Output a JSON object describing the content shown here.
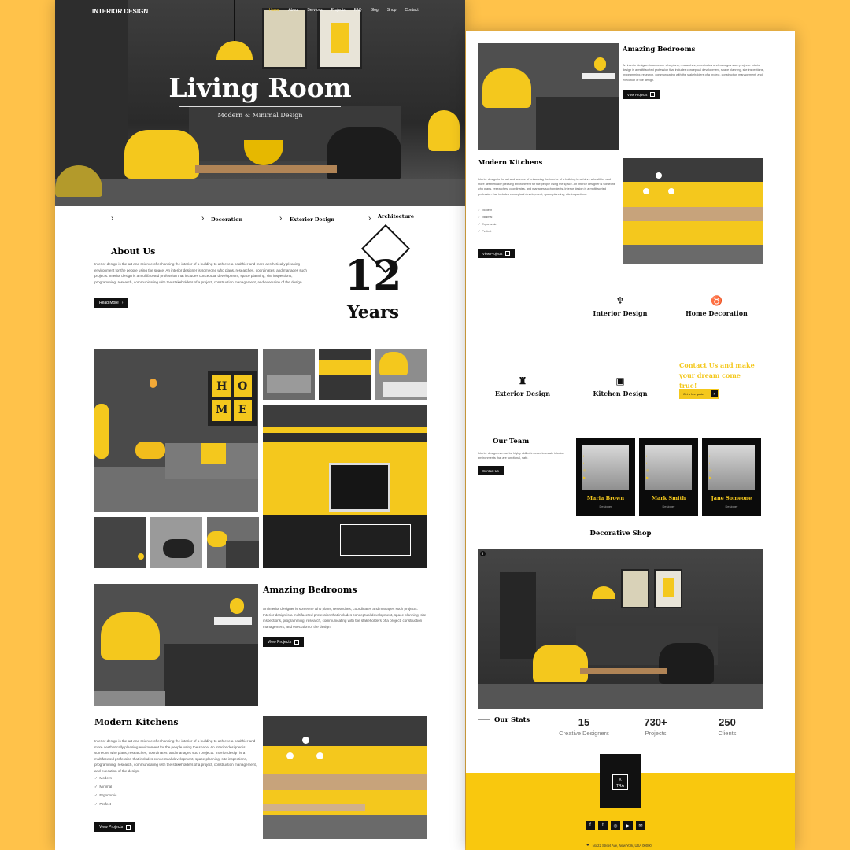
{
  "left": {
    "nav": {
      "brand": "INTERIOR DESIGN",
      "links": [
        "Home",
        "About",
        "Services",
        "Projects",
        "FAQ",
        "Blog",
        "Shop",
        "Contact"
      ]
    },
    "hero": {
      "title": "Living Room",
      "subtitle": "Modern & Minimal Design"
    },
    "categories": [
      "Decoration",
      "Exterior Design",
      "Architecture"
    ],
    "about": {
      "title": "About Us",
      "text": "Interior design is the art and science of enhancing the interior of a building to achieve a healthier and more aesthetically pleasing environment for the people using the space. An interior designer is someone who plans, researches, coordinates, and manages such projects. Interior design is a multifaceted profession that includes conceptual development, space planning, site inspections, programming, research, communicating with the stakeholders of a project, construction management, and execution of the design.",
      "button": "Read More",
      "years_number": "12",
      "years_label": "Years"
    },
    "gallery": {
      "sign_letters": [
        "H",
        "O",
        "M",
        "E"
      ]
    },
    "bedrooms": {
      "title": "Amazing Bedrooms",
      "text": "An interior designer is someone who plans, researches, coordinates and manages such projects. Interior design is a multifaceted profession that includes conceptual development, space planning, site inspections, programming, research, communicating with the stakeholders of a project, construction management, and execution of the design.",
      "button": "View Projects"
    },
    "kitchens": {
      "title": "Modern Kitchens",
      "text": "Interior design is the art and science of enhancing the interior of a building to achieve a healthier and more aesthetically pleasing environment for the people using the space. An interior designer is someone who plans, researches, coordinates, and manages such projects. Interior design is a multifaceted profession that includes conceptual development, space planning, site inspections, programming, research, communicating with the stakeholders of a project, construction management, and execution of the design.",
      "checks": [
        "Modern",
        "Minimal",
        "Ergonomic",
        "Perfect"
      ],
      "button": "View Projects"
    }
  },
  "right": {
    "bedrooms": {
      "title": "Amazing Bedrooms",
      "text": "An interior designer is someone who plans, researches, coordinates and manages such projects. Interior design is a multifaceted profession that includes conceptual development, space planning, site inspections, programming, research, communicating with the stakeholders of a project, construction management, and execution of the design.",
      "button": "View Projects"
    },
    "kitchens": {
      "title": "Modern Kitchens",
      "text": "Interior design is the art and science of enhancing the interior of a building to achieve a healthier and more aesthetically pleasing environment for the people using the space. An interior designer is someone who plans, researches, coordinates, and manages such projects. Interior design is a multifaceted profession that includes conceptual development, space planning, site inspections.",
      "checks": [
        "Modern",
        "Minimal",
        "Ergonomic",
        "Perfect"
      ],
      "button": "View Projects"
    },
    "services": {
      "items": [
        "Interior Design",
        "Home Decoration",
        "Exterior Design",
        "Kitchen Design"
      ],
      "cta_title": "Contact Us and make your dream come true!",
      "cta_button": "Get a free quote"
    },
    "team": {
      "title": "Our Team",
      "text": "Interior designers must be highly skilled in order to create interior environments that are functional, safe.",
      "button": "Contact Us",
      "members": [
        {
          "name": "Maria Brown",
          "role": "Designer"
        },
        {
          "name": "Mark Smith",
          "role": "Designer"
        },
        {
          "name": "Jane Someone",
          "role": "Designer"
        }
      ]
    },
    "shop": {
      "title": "Decorative Shop"
    },
    "stats": {
      "title": "Our Stats",
      "items": [
        {
          "value": "15",
          "label": "Creative Designers"
        },
        {
          "value": "730+",
          "label": "Projects"
        },
        {
          "value": "250",
          "label": "Clients"
        }
      ]
    },
    "footer": {
      "logo_top": "X",
      "logo_bottom": "TRA",
      "social_icons": [
        "facebook-icon",
        "twitter-icon",
        "instagram-icon",
        "youtube-icon",
        "email-icon"
      ],
      "address": "No.22 Street Ave, New York, USA 00000"
    }
  },
  "colors": {
    "accent": "#f4c81d",
    "background": "#ffc24a",
    "dark": "#111111"
  }
}
